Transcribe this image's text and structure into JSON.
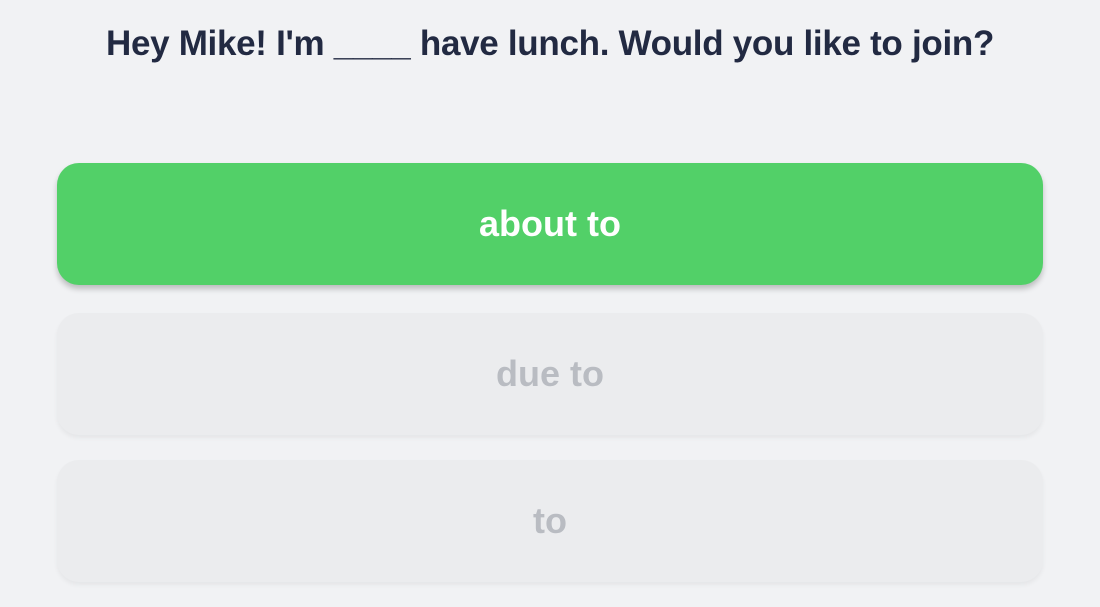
{
  "question": {
    "text": "Hey Mike! I'm ____ have lunch. Would you like to join?"
  },
  "options": [
    {
      "label": "about to",
      "state": "selected",
      "color": "#52d068"
    },
    {
      "label": "due to",
      "state": "disabled"
    },
    {
      "label": "to",
      "state": "disabled"
    }
  ]
}
